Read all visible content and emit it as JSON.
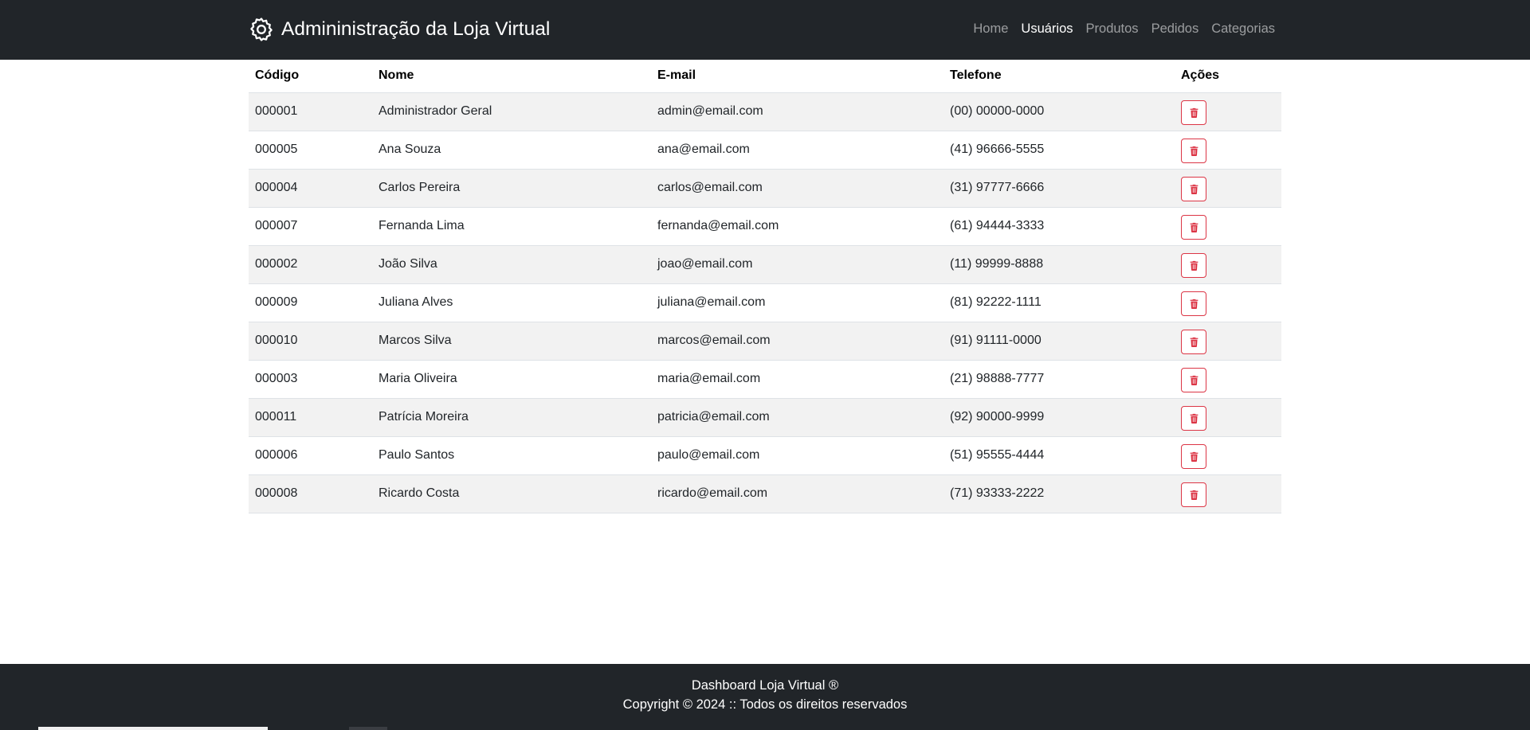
{
  "navbar": {
    "brand_icon": "gear-icon",
    "brand_title": "Admininistração da Loja Virtual",
    "links": [
      {
        "label": "Home",
        "active": false
      },
      {
        "label": "Usuários",
        "active": true
      },
      {
        "label": "Produtos",
        "active": false
      },
      {
        "label": "Pedidos",
        "active": false
      },
      {
        "label": "Categorias",
        "active": false
      }
    ]
  },
  "table": {
    "headers": {
      "code": "Código",
      "name": "Nome",
      "email": "E-mail",
      "phone": "Telefone",
      "actions": "Ações"
    },
    "action_icon": "trash-icon",
    "rows": [
      {
        "code": "000001",
        "name": "Administrador Geral",
        "email": "admin@email.com",
        "phone": "(00) 00000-0000"
      },
      {
        "code": "000005",
        "name": "Ana Souza",
        "email": "ana@email.com",
        "phone": "(41) 96666-5555"
      },
      {
        "code": "000004",
        "name": "Carlos Pereira",
        "email": "carlos@email.com",
        "phone": "(31) 97777-6666"
      },
      {
        "code": "000007",
        "name": "Fernanda Lima",
        "email": "fernanda@email.com",
        "phone": "(61) 94444-3333"
      },
      {
        "code": "000002",
        "name": "João Silva",
        "email": "joao@email.com",
        "phone": "(11) 99999-8888"
      },
      {
        "code": "000009",
        "name": "Juliana Alves",
        "email": "juliana@email.com",
        "phone": "(81) 92222-1111"
      },
      {
        "code": "000010",
        "name": "Marcos Silva",
        "email": "marcos@email.com",
        "phone": "(91) 91111-0000"
      },
      {
        "code": "000003",
        "name": "Maria Oliveira",
        "email": "maria@email.com",
        "phone": "(21) 98888-7777"
      },
      {
        "code": "000011",
        "name": "Patrícia Moreira",
        "email": "patricia@email.com",
        "phone": "(92) 90000-9999"
      },
      {
        "code": "000006",
        "name": "Paulo Santos",
        "email": "paulo@email.com",
        "phone": "(51) 95555-4444"
      },
      {
        "code": "000008",
        "name": "Ricardo Costa",
        "email": "ricardo@email.com",
        "phone": "(71) 93333-2222"
      }
    ]
  },
  "footer": {
    "line1": "Dashboard Loja Virtual ®",
    "line2": "Copyright © 2024 :: Todos os direitos reservados"
  },
  "colors": {
    "navbar_bg": "#212529",
    "danger": "#dc3545",
    "stripe": "#f2f2f2"
  }
}
